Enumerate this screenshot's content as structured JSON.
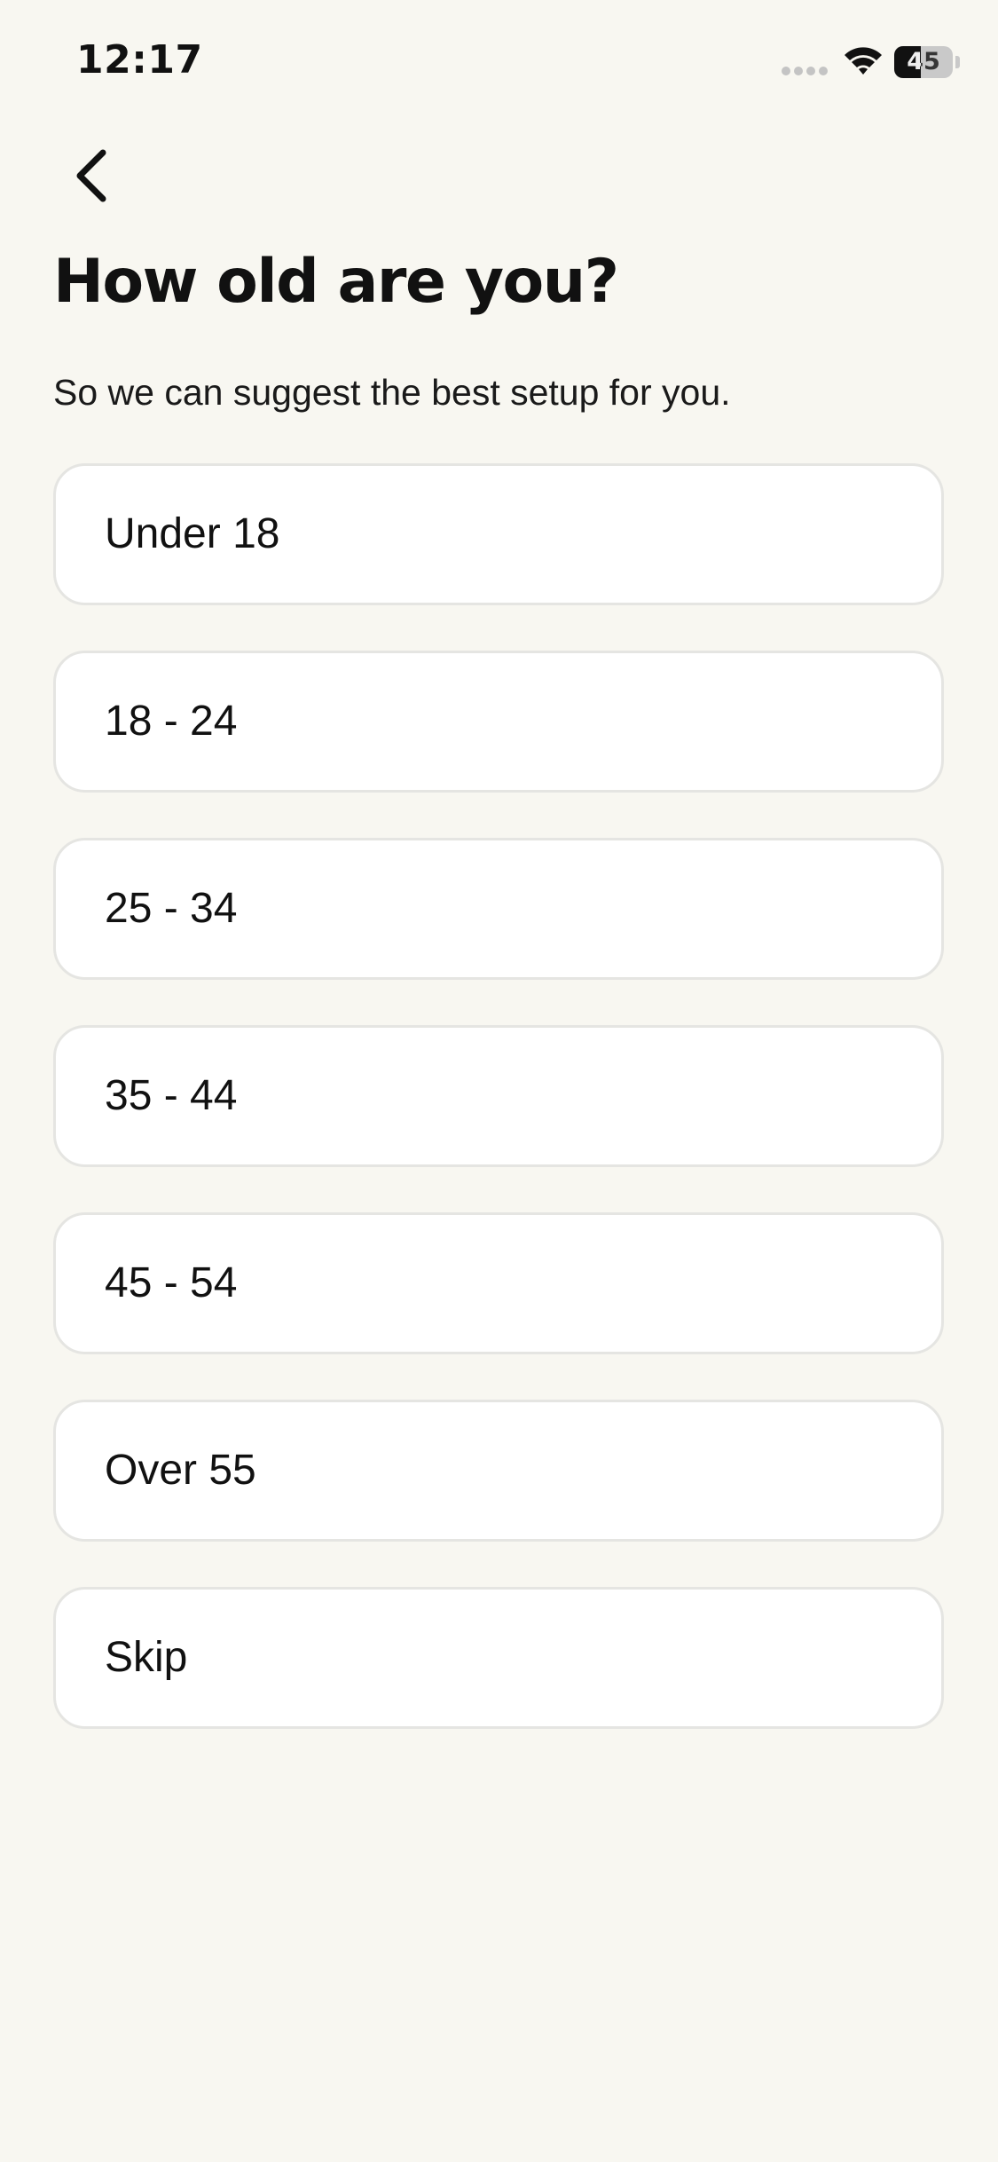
{
  "status_bar": {
    "time": "12:17",
    "battery_level": "45",
    "battery_fraction": 0.45
  },
  "icons": {
    "back": "chevron-left-icon",
    "wifi": "wifi-icon",
    "signal": "cellular-signal-icon",
    "battery": "battery-icon"
  },
  "header": {
    "title": "How old are you?",
    "subtitle": "So we can suggest the best setup for you."
  },
  "options": [
    {
      "label": "Under 18"
    },
    {
      "label": "18 - 24"
    },
    {
      "label": "25 - 34"
    },
    {
      "label": "35 - 44"
    },
    {
      "label": "45 - 54"
    },
    {
      "label": "Over 55"
    },
    {
      "label": "Skip"
    }
  ],
  "colors": {
    "background": "#f8f7f1",
    "card": "#ffffff",
    "card_border": "#e5e5e2",
    "text": "#111111"
  }
}
